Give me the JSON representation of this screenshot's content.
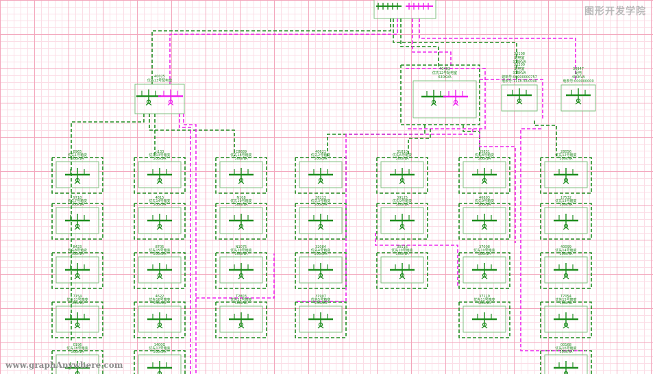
{
  "watermark": "图形开发学院",
  "url": "www.graphAnywhere.com",
  "colors": {
    "green": "#1e8c1e",
    "magenta": "#ee22ee",
    "box": "#7fbf7f"
  },
  "top_station": {
    "id": "top-station",
    "color": "mixed"
  },
  "substations": [
    {
      "id": "sub-left",
      "line1": "40025",
      "line2": "优先13号配电室",
      "color": "mixed"
    },
    {
      "id": "sub-center",
      "line1": "40403",
      "line2": "优先12号配电室",
      "line3": "630KVA",
      "color": "mixed"
    },
    {
      "id": "sub-a",
      "line1": "30200",
      "line2": "配电室",
      "line3": "315KVA",
      "line4": "建筑号:00000000757",
      "line5": "电表号:11187000000",
      "color": "green"
    },
    {
      "id": "sub-b",
      "line1": "30108",
      "line2": "配电室",
      "line3": "315KVA",
      "color": "green"
    },
    {
      "id": "sub-c",
      "line1": "30947",
      "line2": "配电",
      "line3": "400KVA",
      "line4": "电表号:000000000",
      "color": "magenta"
    }
  ],
  "columns": [
    {
      "id": "col-1",
      "nodes": [
        {
          "num": "8965",
          "name": "优先1号箱变",
          "cap": "500kVA",
          "color": "green"
        },
        {
          "num": "9718",
          "name": "优先7号箱变",
          "cap": "500kVA",
          "color": "green"
        },
        {
          "num": "8423",
          "name": "优先8号箱变",
          "cap": "500kVA",
          "color": "green"
        },
        {
          "num": "7154",
          "name": "优先11号箱变",
          "cap": "500kVA",
          "color": "green"
        },
        {
          "num": "0196",
          "name": "优先18号箱变",
          "cap": "500kVA",
          "color": "green"
        }
      ]
    },
    {
      "id": "col-2",
      "nodes": [
        {
          "num": "n133",
          "name": "优先13号箱变",
          "cap": "500kVA",
          "color": "green"
        },
        {
          "num": "4815",
          "name": "优先14号箱变",
          "cap": "500kVA",
          "color": "green"
        },
        {
          "num": "8705",
          "name": "优先15号箱变",
          "cap": "500kVA",
          "color": "green"
        },
        {
          "num": "4622",
          "name": "优先16号箱变",
          "cap": "500kVA",
          "color": "green"
        },
        {
          "num": "1400G",
          "name": "优先17号箱变",
          "cap": "500kVA",
          "color": "green"
        }
      ]
    },
    {
      "id": "col-3",
      "nodes": [
        {
          "num": "C8689",
          "name": "优先18号箱变",
          "cap": "500kVA",
          "color": "green"
        },
        {
          "num": "N108",
          "name": "优先19号箱变",
          "cap": "500kVA",
          "color": "green"
        },
        {
          "num": "N1075",
          "name": "优先20号箱变",
          "cap": "500kVA",
          "color": "green"
        },
        {
          "num": "T2803",
          "name": "优先21号箱变",
          "cap": "500kVA",
          "color": "green"
        }
      ]
    },
    {
      "id": "col-4",
      "nodes": [
        {
          "num": "40621",
          "name": "优先2号箱变",
          "cap": "500kVA",
          "color": "green"
        },
        {
          "num": "38213",
          "name": "优先3号箱变",
          "cap": "500kVA",
          "color": "green"
        },
        {
          "num": "32084",
          "name": "优先4号箱变",
          "cap": "500kVA",
          "color": "magenta"
        },
        {
          "num": "31907",
          "name": "优先5号箱变",
          "cap": "500kVA",
          "color": "magenta"
        }
      ]
    },
    {
      "id": "col-5",
      "nodes": [
        {
          "num": "31810",
          "name": "优先6号箱变",
          "cap": "500kVA",
          "color": "green"
        },
        {
          "num": "39125",
          "name": "优先9号箱变",
          "cap": "500kVA",
          "color": "green"
        },
        {
          "num": "30116",
          "name": "优先10号箱变",
          "cap": "500kVA",
          "color": "magenta"
        }
      ]
    },
    {
      "id": "col-6",
      "nodes": [
        {
          "num": "35831",
          "name": "优先8号箱变",
          "cap": "500kVA",
          "color": "green"
        },
        {
          "num": "46803",
          "name": "优先9号箱变",
          "cap": "500kVA",
          "color": "green"
        },
        {
          "num": "37008",
          "name": "优先10号箱变",
          "cap": "500kVA",
          "color": "green"
        },
        {
          "num": "37119",
          "name": "优先11号箱变",
          "cap": "500kVA",
          "color": "magenta"
        }
      ]
    },
    {
      "id": "col-7",
      "nodes": [
        {
          "num": "28056",
          "name": "优先12号箱变",
          "cap": "500kVA",
          "color": "green"
        },
        {
          "num": "17532",
          "name": "优先13号箱变",
          "cap": "500kVA",
          "color": "green"
        },
        {
          "num": "40099",
          "name": "优先14号箱变",
          "cap": "500kVA",
          "color": "green"
        },
        {
          "num": "T7054",
          "name": "优先15号箱变",
          "cap": "500kVA",
          "color": "magenta"
        },
        {
          "num": "00168",
          "name": "优先16号箱变",
          "cap": "500kVA",
          "color": "magenta"
        }
      ]
    }
  ]
}
